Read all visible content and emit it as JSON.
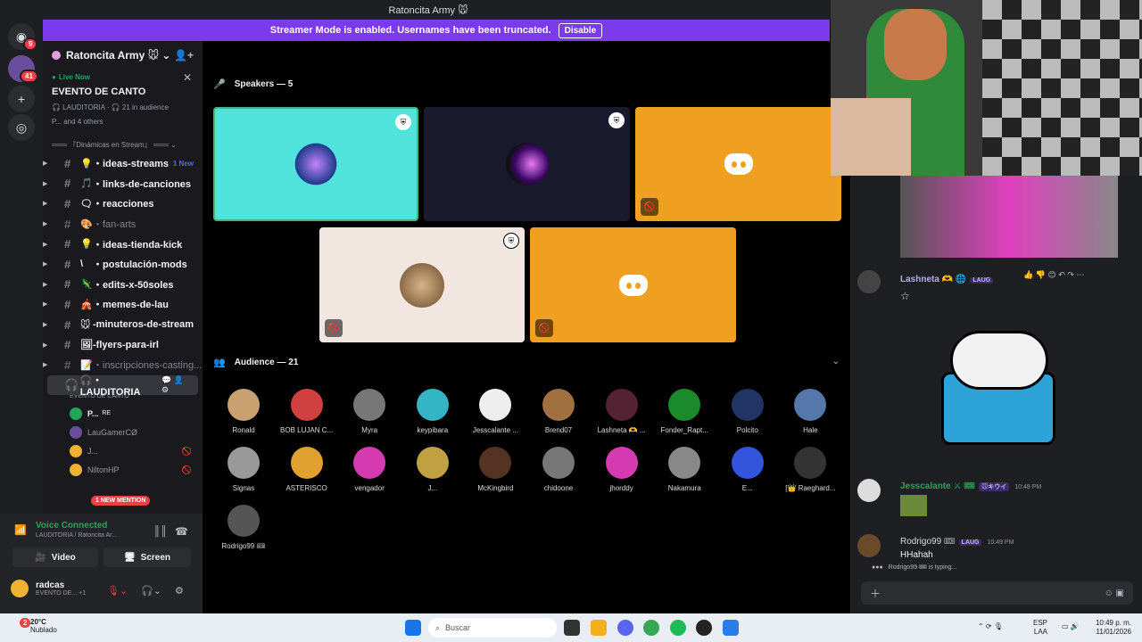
{
  "window": {
    "title": "Ratoncita Army 🐭"
  },
  "rail": {
    "badge_top": "9",
    "badge_server": "41"
  },
  "banner": {
    "text": "Streamer Mode is enabled. Usernames have been truncated.",
    "disable_label": "Disable"
  },
  "server": {
    "name": "Ratoncita Army 🐭 ⌄"
  },
  "live": {
    "label": "Live Now",
    "event": "EVENTO DE CANTO",
    "info": "🎧 LAUDITORIA · 🎧 21 in audience",
    "others": "P... and 4 others"
  },
  "category": "═══ 『Dinámicas en Stream』 ═══ ⌄",
  "channels": [
    {
      "emoji": "💡",
      "name": "・ideas-streams",
      "new": "1 New",
      "style": "bold"
    },
    {
      "emoji": "🎵",
      "name": "・links-de-canciones",
      "new": "",
      "style": "bold"
    },
    {
      "emoji": "🗨",
      "name": "・reacciones",
      "new": "",
      "style": "bold"
    },
    {
      "emoji": "🎨",
      "name": "・fan-arts",
      "new": "",
      "style": "dim"
    },
    {
      "emoji": "💡",
      "name": "・ideas-tienda-kick",
      "new": "",
      "style": "bold"
    },
    {
      "emoji": "\\",
      "name": "・postulación-mods",
      "new": "",
      "style": "bold"
    },
    {
      "emoji": "🦎",
      "name": "・edits-x-50soles",
      "new": "",
      "style": "bold"
    },
    {
      "emoji": "🎪",
      "name": "・memes-de-lau",
      "new": "",
      "style": "bold"
    },
    {
      "emoji": "🐭",
      "name": "-minuteros-de-stream",
      "new": "",
      "style": "bold"
    },
    {
      "emoji": "🖼",
      "name": "-flyers-para-irl",
      "new": "",
      "style": "bold"
    },
    {
      "emoji": "📝",
      "name": "・inscripciones-casting...",
      "new": "",
      "style": "dim"
    }
  ],
  "stage_channel": {
    "name": "🎧・LAUDITORIA",
    "event": "EVENTO DE CANTO"
  },
  "voice_users": [
    {
      "name": "P...",
      "extra": "RE"
    },
    {
      "name": "LauGamerCØ",
      "extra": ""
    },
    {
      "name": "J...",
      "extra": ""
    },
    {
      "name": "NiltonHP",
      "extra": ""
    }
  ],
  "mention_badge": "1 NEW MENTION",
  "voice_panel": {
    "status": "Voice Connected",
    "location": "LAUDITORIA / Ratoncita Ar...",
    "video_label": "Video",
    "screen_label": "Screen",
    "username": "radcas",
    "user_status": "EVENTO DE... +1"
  },
  "stage": {
    "speakers_header": "Speakers — 5",
    "audience_header": "Audience — 21"
  },
  "audience": [
    "Ronald",
    "BOB LUJAN C...",
    "Myra",
    "keypibara",
    "Jesscalante ...",
    "Brend07",
    "Lashneta 🫶 ...",
    "Fonder_Rapt...",
    "Polcito",
    "Hale",
    "Signas",
    "ASTERISCO",
    "vengador",
    "J...",
    "McKingbird",
    "chidoone",
    "jhorddy",
    "Nakamura",
    "E...",
    "[👑 Raeghard...",
    "Rodrigo99 🎟"
  ],
  "chat": {
    "m1_name": "Lashneta 🫶 🌐",
    "m1_tag": "LAUG",
    "m2_name": "Jesscalante ⚔ 🎟",
    "m2_tag": "🐭キウイ",
    "m2_time": "10:48 PM",
    "m3_name": "Rodrigo99 🎟",
    "m3_tag": "LAUG",
    "m3_time": "10:49 PM",
    "m3_text": "HHahah",
    "typing": "Rodrigo99 🎟 is typing..."
  },
  "taskbar": {
    "temp": "20°C",
    "weather": "Nublado",
    "weather_badge": "2",
    "search": "Buscar",
    "lang": "ESP",
    "lang2": "LAA",
    "time": "10:49 p. m.",
    "date": "11/01/2026"
  },
  "colors": {
    "banner": "#7c3aed",
    "tile_cyan": "#4fe3dc",
    "tile_orange": "#f0a020",
    "tile_dark": "#1a1a2e",
    "tile_beige": "#f2e6e0",
    "online": "#23a55a"
  }
}
